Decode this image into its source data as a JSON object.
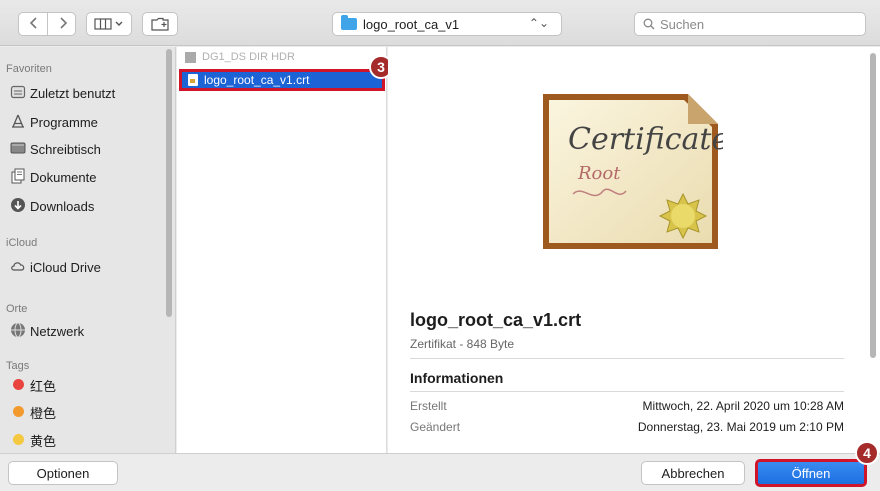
{
  "toolbar": {
    "back_icon": "chevron-left-icon",
    "forward_icon": "chevron-right-icon",
    "view_icon": "column-view-icon",
    "new_folder_icon": "new-folder-icon",
    "path_label": "logo_root_ca_v1",
    "search_placeholder": "Suchen"
  },
  "sidebar": {
    "sections": [
      {
        "title": "Favoriten",
        "items": [
          {
            "label": "Zuletzt benutzt",
            "icon": "recent-icon"
          },
          {
            "label": "Programme",
            "icon": "applications-icon"
          },
          {
            "label": "Schreibtisch",
            "icon": "desktop-icon"
          },
          {
            "label": "Dokumente",
            "icon": "documents-icon"
          },
          {
            "label": "Downloads",
            "icon": "downloads-icon"
          }
        ]
      },
      {
        "title": "iCloud",
        "items": [
          {
            "label": "iCloud Drive",
            "icon": "cloud-icon"
          }
        ]
      },
      {
        "title": "Orte",
        "items": [
          {
            "label": "Netzwerk",
            "icon": "network-icon"
          }
        ]
      },
      {
        "title": "Tags",
        "items": [
          {
            "label": "红色",
            "color": "#e8433f"
          },
          {
            "label": "橙色",
            "color": "#f29a2e"
          },
          {
            "label": "黄色",
            "color": "#f5c842"
          }
        ]
      }
    ]
  },
  "browser": {
    "ghost_row": "DG1_DS DIR HDR",
    "selected_file": "logo_root_ca_v1.crt",
    "step_badge_1": "3",
    "step_badge_2": "4",
    "colors": {
      "selection": "#1c63d6",
      "highlight_border": "#d0152b",
      "badge": "#a52a2a"
    }
  },
  "preview": {
    "cert_title": "Certificate",
    "cert_sub": "Root",
    "file_name": "logo_root_ca_v1.crt",
    "file_info": "Zertifikat - 848 Byte",
    "info_heading": "Informationen",
    "rows": [
      {
        "key": "Erstellt",
        "value": "Mittwoch, 22. April 2020 um 10:28 AM"
      },
      {
        "key": "Geändert",
        "value": "Donnerstag, 23. Mai 2019 um 2:10 PM"
      }
    ]
  },
  "footer": {
    "options_label": "Optionen",
    "cancel_label": "Abbrechen",
    "open_label": "Öffnen"
  }
}
